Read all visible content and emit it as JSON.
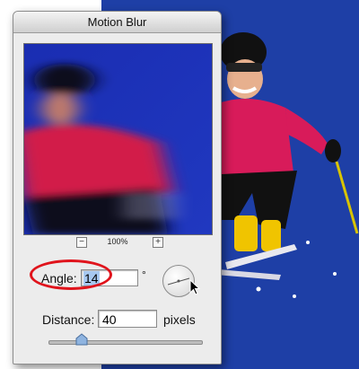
{
  "dialog": {
    "title": "Motion Blur",
    "zoom": {
      "level": "100%",
      "minus": "−",
      "plus": "+"
    },
    "angle": {
      "label": "Angle:",
      "value": "14",
      "unit": "°"
    },
    "distance": {
      "label": "Distance:",
      "value": "40",
      "unit": "pixels",
      "slider_fraction": 0.22
    }
  },
  "colors": {
    "highlight_ring": "#e0141c",
    "sky": "#1e3fa6",
    "selection": "#a7c8f0"
  },
  "icons": [
    "angle-dial-icon",
    "cursor-arrow-icon",
    "zoom-out-icon",
    "zoom-in-icon"
  ]
}
